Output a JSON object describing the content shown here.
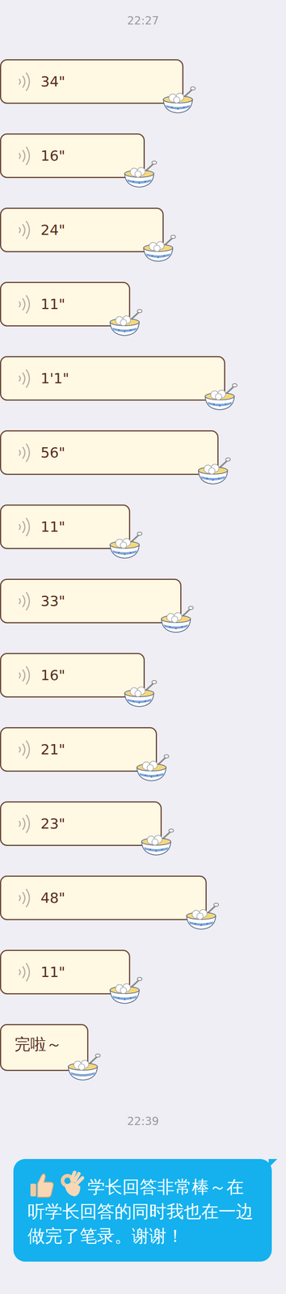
{
  "chat": {
    "messages": [
      {
        "kind": "time",
        "text": "22:27"
      },
      {
        "kind": "voice",
        "sender": "other",
        "duration": "34\""
      },
      {
        "kind": "voice",
        "sender": "other",
        "duration": "16\""
      },
      {
        "kind": "voice",
        "sender": "other",
        "duration": "24\""
      },
      {
        "kind": "voice",
        "sender": "other",
        "duration": "11\""
      },
      {
        "kind": "voice",
        "sender": "other",
        "duration": "1'1\""
      },
      {
        "kind": "voice",
        "sender": "other",
        "duration": "56\""
      },
      {
        "kind": "voice",
        "sender": "other",
        "duration": "11\""
      },
      {
        "kind": "voice",
        "sender": "other",
        "duration": "33\""
      },
      {
        "kind": "voice",
        "sender": "other",
        "duration": "16\""
      },
      {
        "kind": "voice",
        "sender": "other",
        "duration": "21\""
      },
      {
        "kind": "voice",
        "sender": "other",
        "duration": "23\""
      },
      {
        "kind": "voice",
        "sender": "other",
        "duration": "48\""
      },
      {
        "kind": "voice",
        "sender": "other",
        "duration": "11\""
      },
      {
        "kind": "text",
        "sender": "other",
        "text": "完啦～"
      },
      {
        "kind": "time",
        "text": "22:39"
      },
      {
        "kind": "text",
        "sender": "self",
        "text": "学长回答非常棒～在听学长回答的同时我也在一边做完了笔录。谢谢！"
      }
    ]
  }
}
